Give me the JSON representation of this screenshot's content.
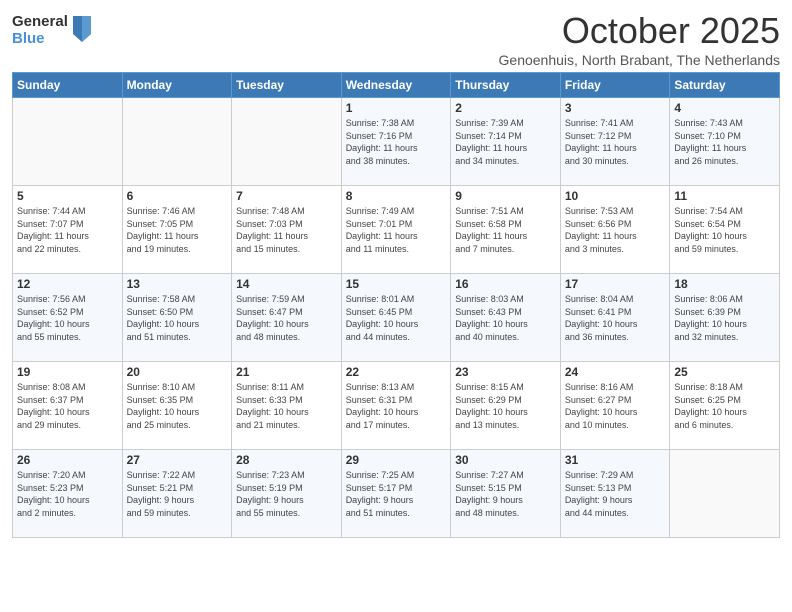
{
  "header": {
    "logo_general": "General",
    "logo_blue": "Blue",
    "month": "October 2025",
    "subtitle": "Genoenhuis, North Brabant, The Netherlands"
  },
  "weekdays": [
    "Sunday",
    "Monday",
    "Tuesday",
    "Wednesday",
    "Thursday",
    "Friday",
    "Saturday"
  ],
  "weeks": [
    [
      {
        "day": "",
        "info": ""
      },
      {
        "day": "",
        "info": ""
      },
      {
        "day": "",
        "info": ""
      },
      {
        "day": "1",
        "info": "Sunrise: 7:38 AM\nSunset: 7:16 PM\nDaylight: 11 hours\nand 38 minutes."
      },
      {
        "day": "2",
        "info": "Sunrise: 7:39 AM\nSunset: 7:14 PM\nDaylight: 11 hours\nand 34 minutes."
      },
      {
        "day": "3",
        "info": "Sunrise: 7:41 AM\nSunset: 7:12 PM\nDaylight: 11 hours\nand 30 minutes."
      },
      {
        "day": "4",
        "info": "Sunrise: 7:43 AM\nSunset: 7:10 PM\nDaylight: 11 hours\nand 26 minutes."
      }
    ],
    [
      {
        "day": "5",
        "info": "Sunrise: 7:44 AM\nSunset: 7:07 PM\nDaylight: 11 hours\nand 22 minutes."
      },
      {
        "day": "6",
        "info": "Sunrise: 7:46 AM\nSunset: 7:05 PM\nDaylight: 11 hours\nand 19 minutes."
      },
      {
        "day": "7",
        "info": "Sunrise: 7:48 AM\nSunset: 7:03 PM\nDaylight: 11 hours\nand 15 minutes."
      },
      {
        "day": "8",
        "info": "Sunrise: 7:49 AM\nSunset: 7:01 PM\nDaylight: 11 hours\nand 11 minutes."
      },
      {
        "day": "9",
        "info": "Sunrise: 7:51 AM\nSunset: 6:58 PM\nDaylight: 11 hours\nand 7 minutes."
      },
      {
        "day": "10",
        "info": "Sunrise: 7:53 AM\nSunset: 6:56 PM\nDaylight: 11 hours\nand 3 minutes."
      },
      {
        "day": "11",
        "info": "Sunrise: 7:54 AM\nSunset: 6:54 PM\nDaylight: 10 hours\nand 59 minutes."
      }
    ],
    [
      {
        "day": "12",
        "info": "Sunrise: 7:56 AM\nSunset: 6:52 PM\nDaylight: 10 hours\nand 55 minutes."
      },
      {
        "day": "13",
        "info": "Sunrise: 7:58 AM\nSunset: 6:50 PM\nDaylight: 10 hours\nand 51 minutes."
      },
      {
        "day": "14",
        "info": "Sunrise: 7:59 AM\nSunset: 6:47 PM\nDaylight: 10 hours\nand 48 minutes."
      },
      {
        "day": "15",
        "info": "Sunrise: 8:01 AM\nSunset: 6:45 PM\nDaylight: 10 hours\nand 44 minutes."
      },
      {
        "day": "16",
        "info": "Sunrise: 8:03 AM\nSunset: 6:43 PM\nDaylight: 10 hours\nand 40 minutes."
      },
      {
        "day": "17",
        "info": "Sunrise: 8:04 AM\nSunset: 6:41 PM\nDaylight: 10 hours\nand 36 minutes."
      },
      {
        "day": "18",
        "info": "Sunrise: 8:06 AM\nSunset: 6:39 PM\nDaylight: 10 hours\nand 32 minutes."
      }
    ],
    [
      {
        "day": "19",
        "info": "Sunrise: 8:08 AM\nSunset: 6:37 PM\nDaylight: 10 hours\nand 29 minutes."
      },
      {
        "day": "20",
        "info": "Sunrise: 8:10 AM\nSunset: 6:35 PM\nDaylight: 10 hours\nand 25 minutes."
      },
      {
        "day": "21",
        "info": "Sunrise: 8:11 AM\nSunset: 6:33 PM\nDaylight: 10 hours\nand 21 minutes."
      },
      {
        "day": "22",
        "info": "Sunrise: 8:13 AM\nSunset: 6:31 PM\nDaylight: 10 hours\nand 17 minutes."
      },
      {
        "day": "23",
        "info": "Sunrise: 8:15 AM\nSunset: 6:29 PM\nDaylight: 10 hours\nand 13 minutes."
      },
      {
        "day": "24",
        "info": "Sunrise: 8:16 AM\nSunset: 6:27 PM\nDaylight: 10 hours\nand 10 minutes."
      },
      {
        "day": "25",
        "info": "Sunrise: 8:18 AM\nSunset: 6:25 PM\nDaylight: 10 hours\nand 6 minutes."
      }
    ],
    [
      {
        "day": "26",
        "info": "Sunrise: 7:20 AM\nSunset: 5:23 PM\nDaylight: 10 hours\nand 2 minutes."
      },
      {
        "day": "27",
        "info": "Sunrise: 7:22 AM\nSunset: 5:21 PM\nDaylight: 9 hours\nand 59 minutes."
      },
      {
        "day": "28",
        "info": "Sunrise: 7:23 AM\nSunset: 5:19 PM\nDaylight: 9 hours\nand 55 minutes."
      },
      {
        "day": "29",
        "info": "Sunrise: 7:25 AM\nSunset: 5:17 PM\nDaylight: 9 hours\nand 51 minutes."
      },
      {
        "day": "30",
        "info": "Sunrise: 7:27 AM\nSunset: 5:15 PM\nDaylight: 9 hours\nand 48 minutes."
      },
      {
        "day": "31",
        "info": "Sunrise: 7:29 AM\nSunset: 5:13 PM\nDaylight: 9 hours\nand 44 minutes."
      },
      {
        "day": "",
        "info": ""
      }
    ]
  ]
}
